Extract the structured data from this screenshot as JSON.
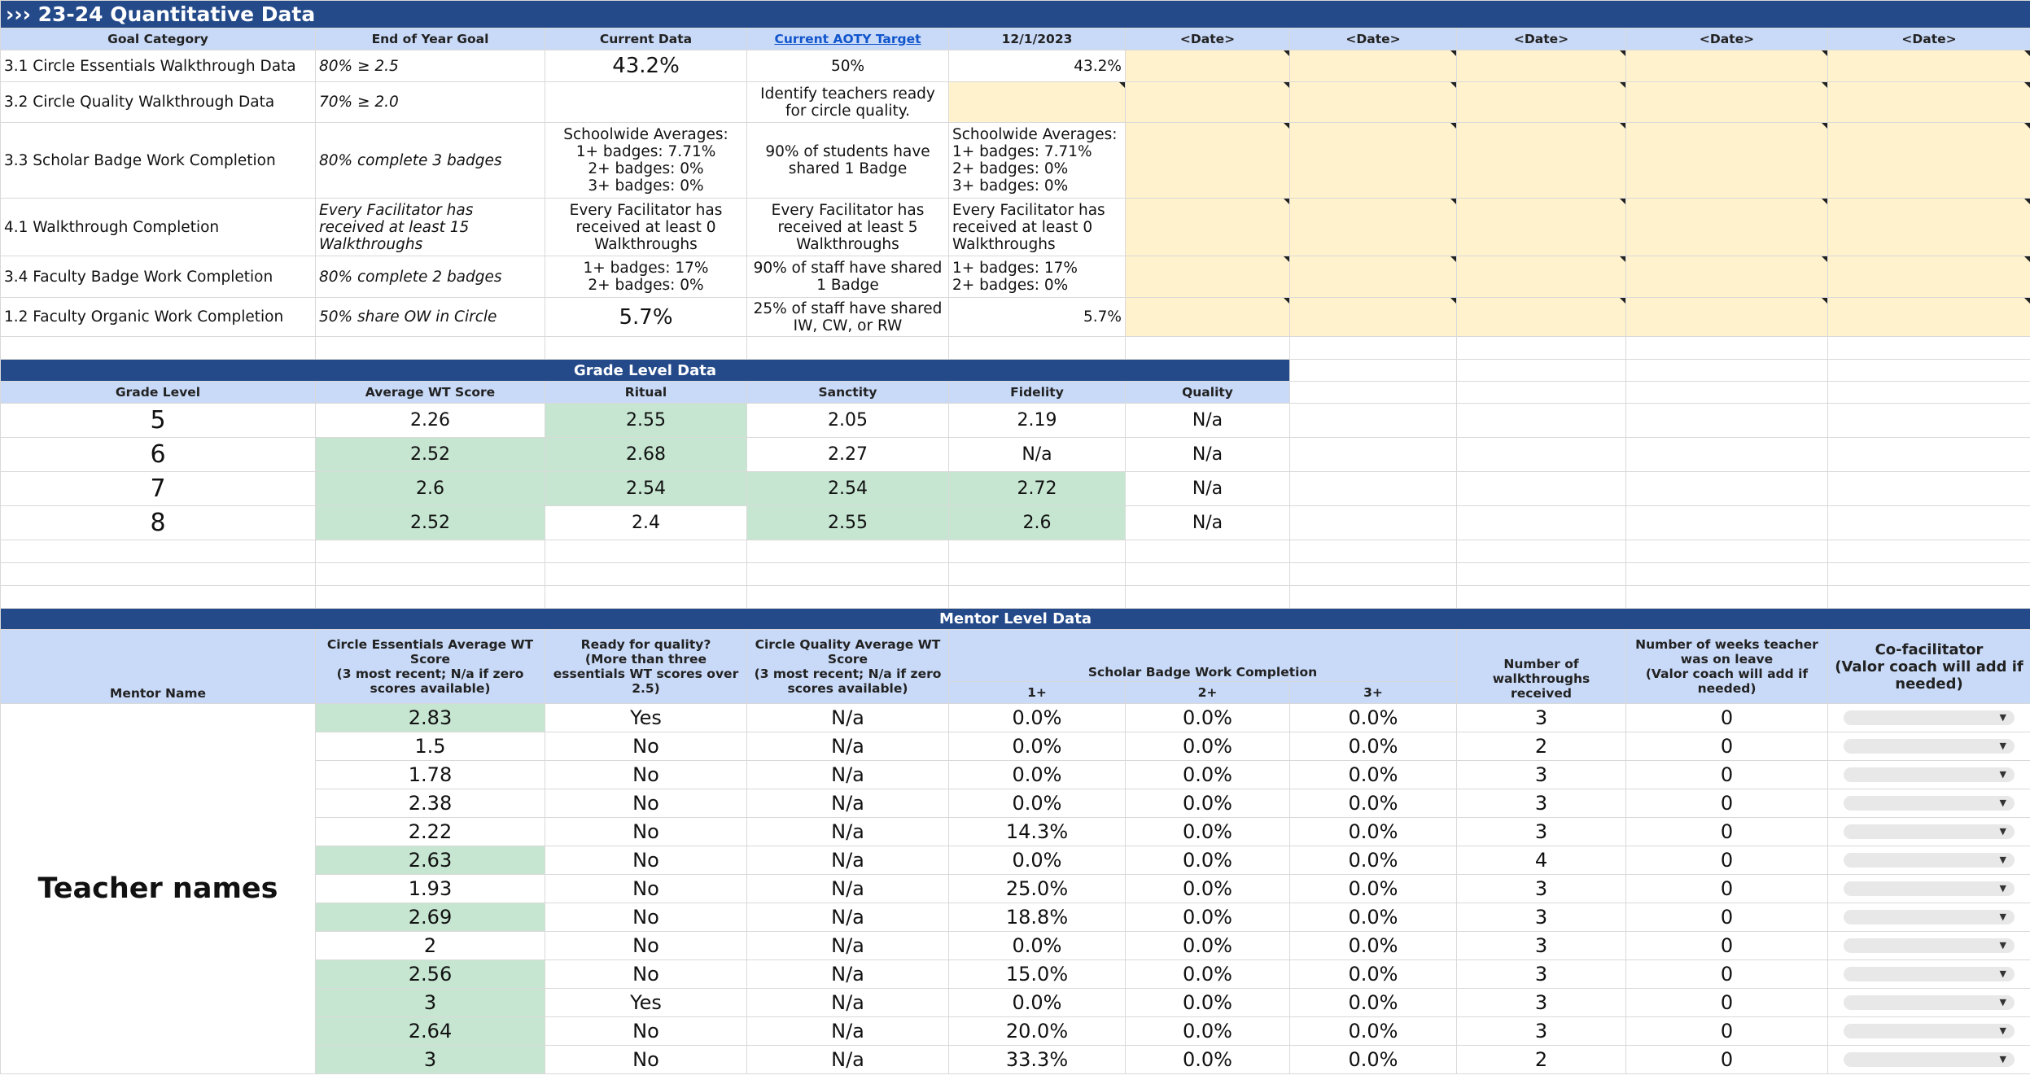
{
  "title": "››› 23-24 Quantitative Data",
  "goals": {
    "headers": [
      "Goal Category",
      "End of Year Goal",
      "Current Data",
      "Current  AOTY Target",
      "12/1/2023",
      "<Date>",
      "<Date>",
      "<Date>",
      "<Date>",
      "<Date>"
    ],
    "rows": [
      {
        "cat": "3.1  Circle Essentials Walkthrough Data",
        "goal": "80% ≥ 2.5",
        "current": "43.2%",
        "target": "50%",
        "dec": "43.2%"
      },
      {
        "cat": "3.2  Circle Quality Walkthrough Data",
        "goal": "70% ≥ 2.0",
        "current": "",
        "target": "Identify teachers ready for circle quality.",
        "dec": ""
      },
      {
        "cat": "3.3  Scholar Badge Work Completion",
        "goal": "80% complete 3 badges",
        "current": "Schoolwide Averages:\n1+ badges: 7.71%\n2+ badges: 0%\n3+ badges: 0%",
        "target": "90% of students have shared 1 Badge",
        "dec": "Schoolwide Averages:\n1+ badges: 7.71%\n2+ badges: 0%\n3+ badges: 0%"
      },
      {
        "cat": "4.1  Walkthrough Completion",
        "goal": "Every Facilitator has received at least 15 Walkthroughs",
        "current": "Every Facilitator has received at least 0 Walkthroughs",
        "target": "Every Facilitator has received at least 5 Walkthroughs",
        "dec": "Every Facilitator has received at least 0 Walkthroughs"
      },
      {
        "cat": "3.4  Faculty Badge Work Completion",
        "goal": "80% complete 2 badges",
        "current": "1+ badges: 17%\n2+ badges: 0%",
        "target": "90% of staff have shared 1 Badge",
        "dec": "1+ badges: 17%\n2+ badges: 0%"
      },
      {
        "cat": "1.2  Faculty Organic Work Completion",
        "goal": "50% share OW in Circle",
        "current": "5.7%",
        "target": "25% of staff have shared IW, CW, or RW",
        "dec": "5.7%"
      }
    ]
  },
  "grade": {
    "band": "Grade Level Data",
    "headers": [
      "Grade Level",
      "Average WT Score",
      "Ritual",
      "Sanctity",
      "Fidelity",
      "Quality"
    ],
    "rows": [
      {
        "g": "5",
        "avg": "2.26",
        "ritual": "2.55",
        "sanctity": "2.05",
        "fidelity": "2.19",
        "quality": "N/a"
      },
      {
        "g": "6",
        "avg": "2.52",
        "ritual": "2.68",
        "sanctity": "2.27",
        "fidelity": "N/a",
        "quality": "N/a"
      },
      {
        "g": "7",
        "avg": "2.6",
        "ritual": "2.54",
        "sanctity": "2.54",
        "fidelity": "2.72",
        "quality": "N/a"
      },
      {
        "g": "8",
        "avg": "2.52",
        "ritual": "2.4",
        "sanctity": "2.55",
        "fidelity": "2.6",
        "quality": "N/a"
      }
    ]
  },
  "mentor": {
    "band": "Mentor Level Data",
    "h_name": "Mentor Name",
    "h_ce": "Circle Essentials Average WT Score\n(3 most recent; N/a if zero scores available)",
    "h_ready": "Ready for quality?\n(More than three essentials WT scores over 2.5)",
    "h_cq": "Circle Quality Average WT Score\n(3 most recent; N/a if zero scores available)",
    "h_badge": "Scholar Badge Work Completion",
    "h_b1": "1+",
    "h_b2": "2+",
    "h_b3": "3+",
    "h_wt": "Number of walkthroughs received",
    "h_leave": "Number of weeks teacher was on leave\n(Valor coach will add if needed)",
    "h_cofac": "Co-facilitator\n(Valor coach will add if needed)",
    "teacher_label": "Teacher names",
    "rows": [
      {
        "ce": "2.83",
        "ready": "Yes",
        "cq": "N/a",
        "b1": "0.0%",
        "b2": "0.0%",
        "b3": "0.0%",
        "wt": "3",
        "leave": "0"
      },
      {
        "ce": "1.5",
        "ready": "No",
        "cq": "N/a",
        "b1": "0.0%",
        "b2": "0.0%",
        "b3": "0.0%",
        "wt": "2",
        "leave": "0"
      },
      {
        "ce": "1.78",
        "ready": "No",
        "cq": "N/a",
        "b1": "0.0%",
        "b2": "0.0%",
        "b3": "0.0%",
        "wt": "3",
        "leave": "0"
      },
      {
        "ce": "2.38",
        "ready": "No",
        "cq": "N/a",
        "b1": "0.0%",
        "b2": "0.0%",
        "b3": "0.0%",
        "wt": "3",
        "leave": "0"
      },
      {
        "ce": "2.22",
        "ready": "No",
        "cq": "N/a",
        "b1": "14.3%",
        "b2": "0.0%",
        "b3": "0.0%",
        "wt": "3",
        "leave": "0"
      },
      {
        "ce": "2.63",
        "ready": "No",
        "cq": "N/a",
        "b1": "0.0%",
        "b2": "0.0%",
        "b3": "0.0%",
        "wt": "4",
        "leave": "0"
      },
      {
        "ce": "1.93",
        "ready": "No",
        "cq": "N/a",
        "b1": "25.0%",
        "b2": "0.0%",
        "b3": "0.0%",
        "wt": "3",
        "leave": "0"
      },
      {
        "ce": "2.69",
        "ready": "No",
        "cq": "N/a",
        "b1": "18.8%",
        "b2": "0.0%",
        "b3": "0.0%",
        "wt": "3",
        "leave": "0"
      },
      {
        "ce": "2",
        "ready": "No",
        "cq": "N/a",
        "b1": "0.0%",
        "b2": "0.0%",
        "b3": "0.0%",
        "wt": "3",
        "leave": "0"
      },
      {
        "ce": "2.56",
        "ready": "No",
        "cq": "N/a",
        "b1": "15.0%",
        "b2": "0.0%",
        "b3": "0.0%",
        "wt": "3",
        "leave": "0"
      },
      {
        "ce": "3",
        "ready": "Yes",
        "cq": "N/a",
        "b1": "0.0%",
        "b2": "0.0%",
        "b3": "0.0%",
        "wt": "3",
        "leave": "0"
      },
      {
        "ce": "2.64",
        "ready": "No",
        "cq": "N/a",
        "b1": "20.0%",
        "b2": "0.0%",
        "b3": "0.0%",
        "wt": "3",
        "leave": "0"
      },
      {
        "ce": "3",
        "ready": "No",
        "cq": "N/a",
        "b1": "33.3%",
        "b2": "0.0%",
        "b3": "0.0%",
        "wt": "2",
        "leave": "0"
      }
    ]
  },
  "colors": {
    "navy": "#244a8a",
    "header": "#c9daf8",
    "highlight": "#c6e6d1",
    "yellow": "#fff2cc"
  }
}
